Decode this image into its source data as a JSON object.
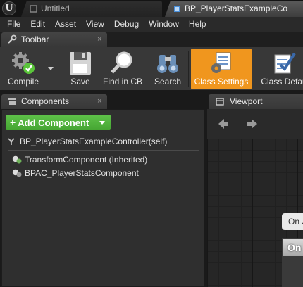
{
  "document_tabs": [
    {
      "label": "Untitled",
      "active": false
    },
    {
      "label": "BP_PlayerStatsExampleCo",
      "active": true
    }
  ],
  "menu": [
    "File",
    "Edit",
    "Asset",
    "View",
    "Debug",
    "Window",
    "Help"
  ],
  "toolbar_tab": {
    "label": "Toolbar",
    "close": "×"
  },
  "toolbar": {
    "compile": "Compile",
    "save": "Save",
    "find_in_cb": "Find in CB",
    "search": "Search",
    "class_settings": "Class Settings",
    "class_defaults": "Class Defau"
  },
  "components_tab": {
    "label": "Components",
    "close": "×"
  },
  "components": {
    "add_button": "Add Component",
    "root": "BP_PlayerStatsExampleController(self)",
    "items": [
      {
        "label": "TransformComponent (Inherited)"
      },
      {
        "label": "BPAC_PlayerStatsComponent"
      }
    ]
  },
  "viewport_tab": {
    "label": "Viewport"
  },
  "graph_node": {
    "tip": "On J",
    "header": "On"
  },
  "colors": {
    "accent_active": "#f0961e",
    "add_button": "#52b43d",
    "compile_ok": "#5ac53a"
  }
}
